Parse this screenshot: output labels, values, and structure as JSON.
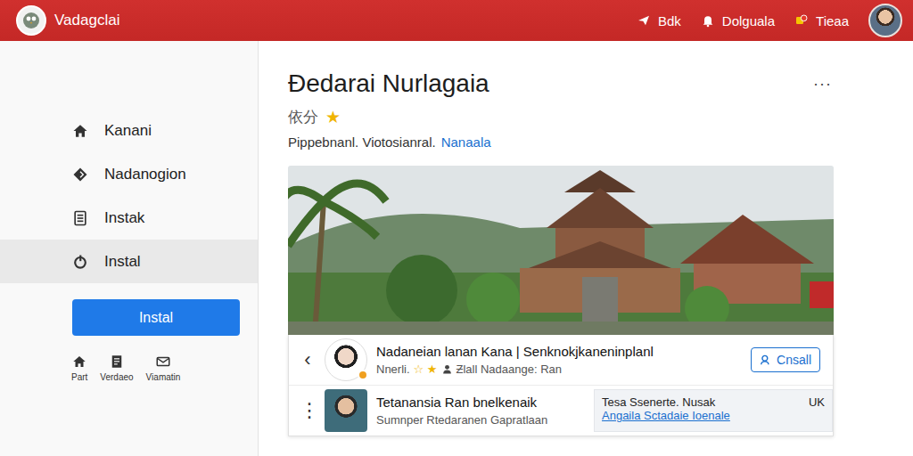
{
  "header": {
    "logo": "Vadagclai",
    "actions": [
      {
        "label": "Bdk",
        "kind": "send"
      },
      {
        "label": "Dolguala",
        "kind": "bell"
      },
      {
        "label": "Tieaa",
        "kind": "badge"
      }
    ]
  },
  "sidebar": {
    "items": [
      {
        "label": "Kanani",
        "kind": "home",
        "selected": false
      },
      {
        "label": "Nadanogion",
        "kind": "diamond",
        "selected": false
      },
      {
        "label": "Instak",
        "kind": "building",
        "selected": false
      },
      {
        "label": "Instal",
        "kind": "circle",
        "selected": true
      }
    ],
    "button": "Instal",
    "shortcuts": [
      {
        "label": "Part",
        "kind": "home"
      },
      {
        "label": "Verdaeo",
        "kind": "doc"
      },
      {
        "label": "Viamatin",
        "kind": "mail"
      }
    ]
  },
  "page": {
    "title": "Ðedarai Nurlagaia",
    "more": "···",
    "rating": "依分",
    "star": "★",
    "subtitle": "Pippebnanl. Viotosianral.",
    "link": "Nanaala"
  },
  "card": {
    "back": "‹",
    "title": "Nadaneian lanan Kana | Senknokjkaneninplanl",
    "meta": "Nnerli.",
    "meta_stars": "☆ ★",
    "meta2": "Ƶlall Nadaange: Ran",
    "button": "Cnsall"
  },
  "row": {
    "menu": "⋮",
    "title": "Tetanansia Ran bnelkenaik",
    "subtitle": "Sumnper Rtedaranen Gapratlaan",
    "box": {
      "line1": "Tesa Ssenerte. Nusak",
      "line2": "Angaila Sctadaie Ioenale",
      "code": "UK"
    }
  }
}
